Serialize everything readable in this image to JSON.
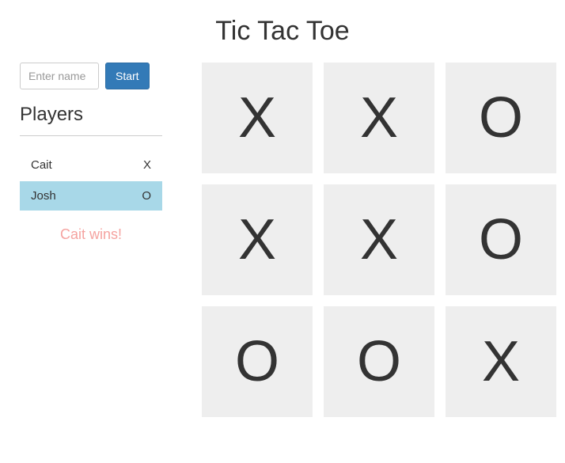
{
  "title": "Tic Tac Toe",
  "form": {
    "name_placeholder": "Enter name",
    "start_label": "Start"
  },
  "sidebar": {
    "players_heading": "Players",
    "players": [
      {
        "name": "Cait",
        "symbol": "X",
        "active": false
      },
      {
        "name": "Josh",
        "symbol": "O",
        "active": true
      }
    ],
    "status": "Cait wins!"
  },
  "board": {
    "cells": [
      "X",
      "X",
      "O",
      "X",
      "X",
      "O",
      "O",
      "O",
      "X"
    ]
  }
}
